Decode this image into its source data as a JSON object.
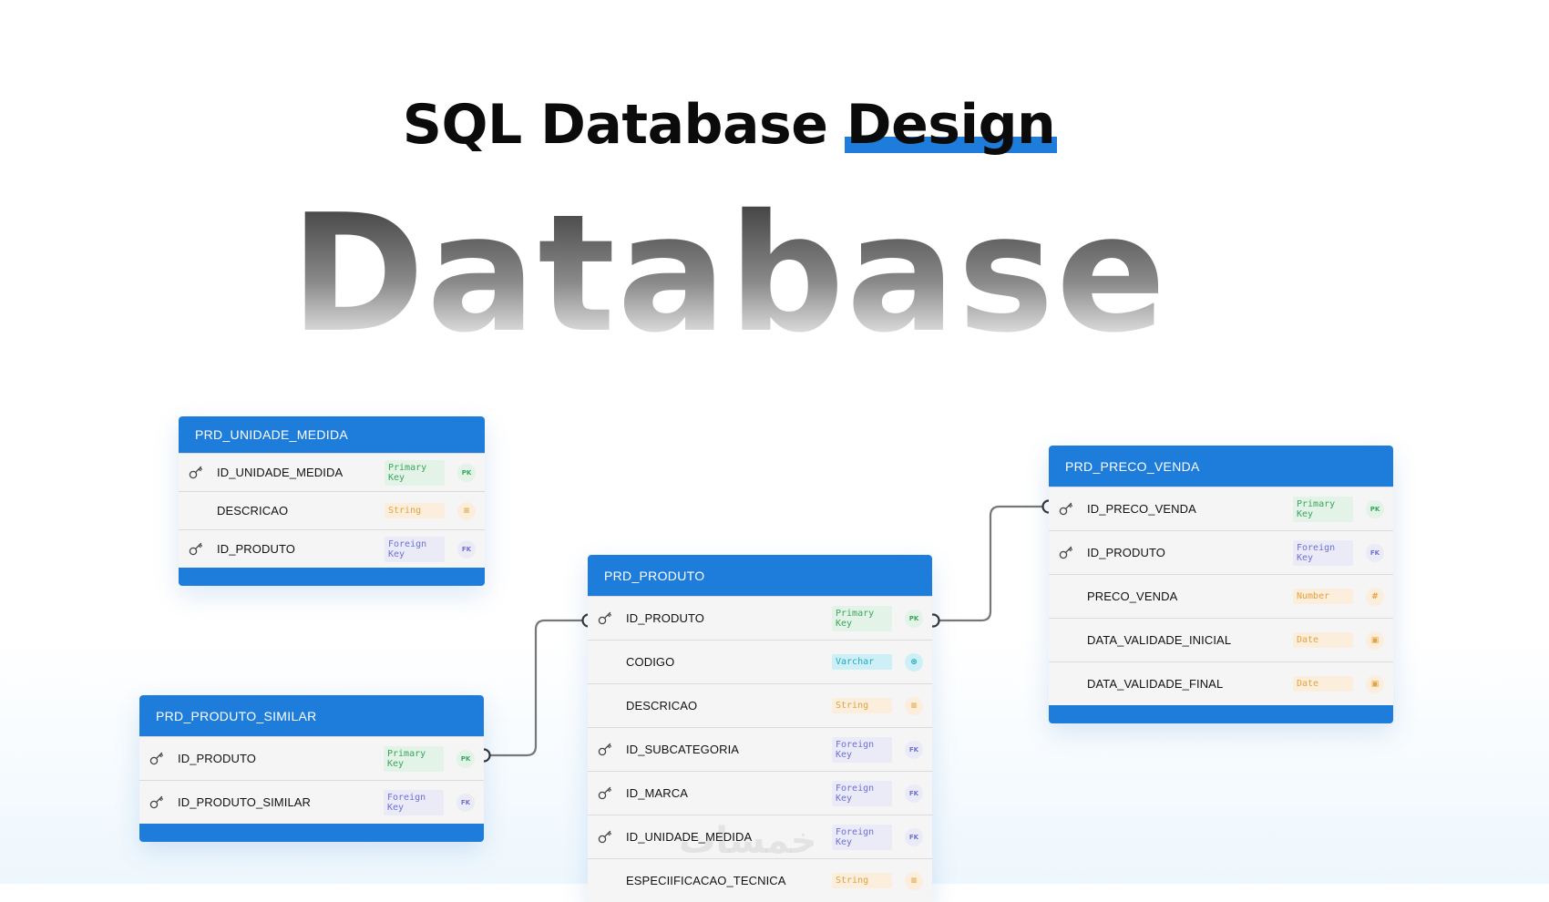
{
  "heading": {
    "prefix": "SQL Database",
    "highlight": "Design"
  },
  "hero_word": "Database",
  "watermark": "خمسات",
  "colors": {
    "accent": "#1e7ddb",
    "primary_key": "#3aa55d",
    "foreign_key": "#6c70d4",
    "string": "#e4a23c",
    "varchar": "#25a7c2"
  },
  "tables": {
    "unidade_medida": {
      "name": "PRD_UNIDADE_MEDIDA",
      "fields": [
        {
          "name": "ID_UNIDADE_MEDIDA",
          "type": "Primary Key",
          "icon": "PK",
          "key_icon": true
        },
        {
          "name": "DESCRICAO",
          "type": "String",
          "icon": "string-icon",
          "key_icon": false
        },
        {
          "name": "ID_PRODUTO",
          "type": "Foreign Key",
          "icon": "FK",
          "key_icon": true
        }
      ]
    },
    "produto_similar": {
      "name": "PRD_PRODUTO_SIMILAR",
      "fields": [
        {
          "name": "ID_PRODUTO",
          "type": "Primary Key",
          "icon": "PK",
          "key_icon": true
        },
        {
          "name": "ID_PRODUTO_SIMILAR",
          "type": "Foreign Key",
          "icon": "FK",
          "key_icon": true
        }
      ]
    },
    "produto": {
      "name": "PRD_PRODUTO",
      "fields": [
        {
          "name": "ID_PRODUTO",
          "type": "Primary Key",
          "icon": "PK",
          "key_icon": true
        },
        {
          "name": "CODIGO",
          "type": "Varchar",
          "icon": "varchar-icon",
          "key_icon": false
        },
        {
          "name": "DESCRICAO",
          "type": "String",
          "icon": "string-icon",
          "key_icon": false
        },
        {
          "name": "ID_SUBCATEGORIA",
          "type": "Foreign Key",
          "icon": "FK",
          "key_icon": true
        },
        {
          "name": "ID_MARCA",
          "type": "Foreign Key",
          "icon": "FK",
          "key_icon": true
        },
        {
          "name": "ID_UNIDADE_MEDIDA",
          "type": "Foreign Key",
          "icon": "FK",
          "key_icon": true
        },
        {
          "name": "ESPECIIFICACAO_TECNICA",
          "type": "String",
          "icon": "string-icon",
          "key_icon": false
        }
      ]
    },
    "preco_venda": {
      "name": "PRD_PRECO_VENDA",
      "fields": [
        {
          "name": "ID_PRECO_VENDA",
          "type": "Primary Key",
          "icon": "PK",
          "key_icon": true
        },
        {
          "name": "ID_PRODUTO",
          "type": "Foreign Key",
          "icon": "FK",
          "key_icon": true
        },
        {
          "name": "PRECO_VENDA",
          "type": "Number",
          "icon": "number-icon",
          "key_icon": false
        },
        {
          "name": "DATA_VALIDADE_INICIAL",
          "type": "Date",
          "icon": "date-icon",
          "key_icon": false
        },
        {
          "name": "DATA_VALIDADE_FINAL",
          "type": "Date",
          "icon": "date-icon",
          "key_icon": false
        }
      ]
    }
  }
}
